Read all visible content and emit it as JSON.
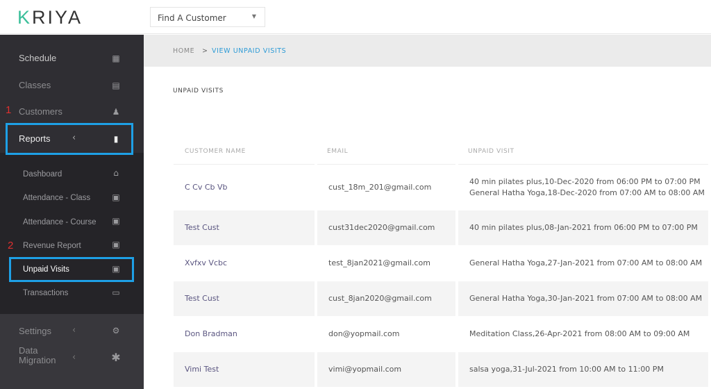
{
  "header": {
    "logo": "KRIYA",
    "customer_select": "Find A Customer"
  },
  "sidebar": {
    "items": [
      {
        "label": "Schedule",
        "icon": "calendar-icon"
      },
      {
        "label": "Classes",
        "icon": "list-icon"
      },
      {
        "label": "Customers",
        "icon": "user-graduate-icon"
      },
      {
        "label": "Reports",
        "icon": "file-icon"
      }
    ],
    "reports_sub": [
      {
        "label": "Dashboard",
        "icon": "home-icon"
      },
      {
        "label": "Attendance - Class",
        "icon": "archive-icon"
      },
      {
        "label": "Attendance - Course",
        "icon": "archive-icon"
      },
      {
        "label": "Revenue Report",
        "icon": "archive-icon"
      },
      {
        "label": "Unpaid Visits",
        "icon": "archive-icon"
      },
      {
        "label": "Transactions",
        "icon": "money-icon"
      }
    ],
    "lower": [
      {
        "label": "Settings",
        "icon": "gear-icon"
      },
      {
        "label": "Data Migration",
        "icon": "asterisk-icon"
      }
    ],
    "annotations": [
      "1",
      "2"
    ]
  },
  "breadcrumb": {
    "home": "HOME",
    "sep": ">",
    "current": "VIEW UNPAID VISITS"
  },
  "page_title": "UNPAID VISITS",
  "table": {
    "headers": [
      "CUSTOMER NAME",
      "EMAIL",
      "UNPAID VISIT"
    ],
    "rows": [
      {
        "name": "C Cv Cb Vb",
        "email": "cust_18m_201@gmail.com",
        "visits": [
          "40 min pilates plus,10-Dec-2020 from 06:00 PM to 07:00 PM",
          "General Hatha Yoga,18-Dec-2020 from 07:00 AM to 08:00 AM"
        ]
      },
      {
        "name": "Test Cust",
        "email": "cust31dec2020@gmail.com",
        "visits": [
          "40 min pilates plus,08-Jan-2021 from 06:00 PM to 07:00 PM"
        ]
      },
      {
        "name": "Xvfxv Vcbc",
        "email": "test_8jan2021@gmail.com",
        "visits": [
          "General Hatha Yoga,27-Jan-2021 from 07:00 AM to 08:00 AM"
        ]
      },
      {
        "name": "Test Cust",
        "email": "cust_8jan2020@gmail.com",
        "visits": [
          "General Hatha Yoga,30-Jan-2021 from 07:00 AM to 08:00 AM"
        ]
      },
      {
        "name": "Don Bradman",
        "email": "don@yopmail.com",
        "visits": [
          "Meditation Class,26-Apr-2021 from 08:00 AM to 09:00 AM"
        ]
      },
      {
        "name": "Vimi Test",
        "email": "vimi@yopmail.com",
        "visits": [
          "salsa yoga,31-Jul-2021 from 10:00 AM to 11:00 PM"
        ]
      }
    ]
  },
  "colors": {
    "accent": "#1ea0e6",
    "sidebar": "#2f2e33",
    "link": "#2d9bd6",
    "name": "#5a5580"
  }
}
